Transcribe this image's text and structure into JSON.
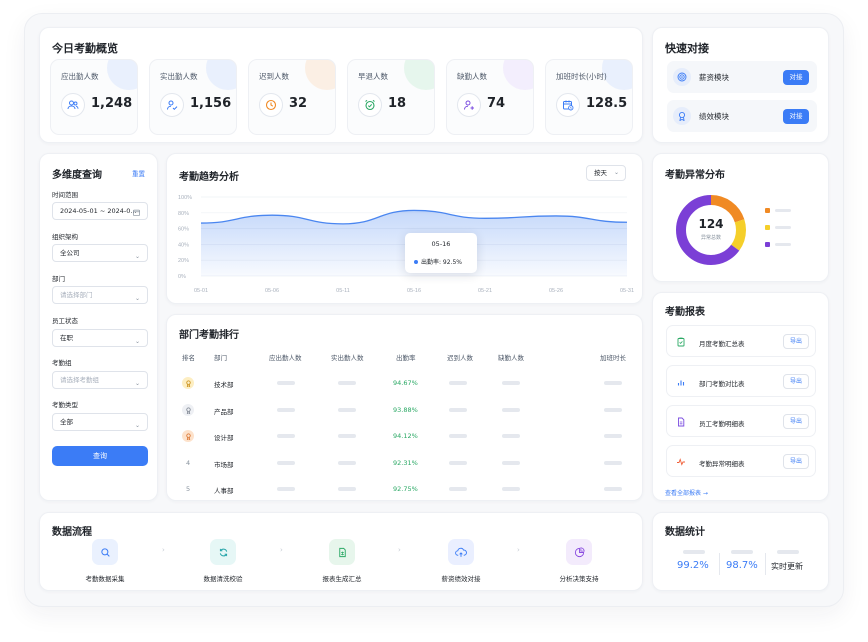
{
  "overview": {
    "title": "今日考勤概览",
    "stats": [
      {
        "label": "应出勤人数",
        "value": "1,248",
        "icon": "users-icon",
        "color": "#3b7cf6"
      },
      {
        "label": "实出勤人数",
        "value": "1,156",
        "icon": "user-check-icon",
        "color": "#3b7cf6"
      },
      {
        "label": "迟到人数",
        "value": "32",
        "icon": "clock-icon",
        "color": "#f08a24"
      },
      {
        "label": "早退人数",
        "value": "18",
        "icon": "alarm-icon",
        "color": "#2aa864"
      },
      {
        "label": "缺勤人数",
        "value": "74",
        "icon": "user-minus-icon",
        "color": "#7b4de0"
      },
      {
        "label": "加班时长(小时)",
        "value": "128.5",
        "icon": "calendar-clock-icon",
        "color": "#3b7cf6"
      }
    ]
  },
  "quick": {
    "title": "快速对接",
    "items": [
      {
        "label": "薪资模块",
        "button": "对接",
        "icon": "target-icon"
      },
      {
        "label": "绩效模块",
        "button": "对接",
        "icon": "award-icon"
      }
    ]
  },
  "query": {
    "title": "多维度查询",
    "reset": "重置",
    "fields": [
      {
        "label": "时间范围",
        "value": "2024-05-01 ~ 2024-0...",
        "placeholder": false,
        "suffix": "calendar"
      },
      {
        "label": "组织架构",
        "value": "全公司",
        "placeholder": false,
        "suffix": "chevron"
      },
      {
        "label": "部门",
        "value": "请选择部门",
        "placeholder": true,
        "suffix": "chevron"
      },
      {
        "label": "员工状态",
        "value": "在职",
        "placeholder": false,
        "suffix": "chevron"
      },
      {
        "label": "考勤组",
        "value": "请选择考勤组",
        "placeholder": true,
        "suffix": "chevron"
      },
      {
        "label": "考勤类型",
        "value": "全部",
        "placeholder": false,
        "suffix": "chevron"
      }
    ],
    "submit": "查询"
  },
  "trend": {
    "title": "考勤趋势分析",
    "period_select": "按天",
    "tooltip": {
      "date": "05-16",
      "label": "出勤率: 92.5%"
    }
  },
  "chart_data": {
    "type": "area",
    "x": [
      "05-01",
      "05-06",
      "05-11",
      "05-16",
      "05-21",
      "05-26",
      "05-31"
    ],
    "series": [
      {
        "values": [
          67,
          77,
          66,
          83,
          73,
          76,
          68
        ]
      }
    ],
    "yticks": [
      "100%",
      "80%",
      "60%",
      "40%",
      "20%",
      "0%"
    ],
    "ylim": [
      0,
      100
    ],
    "color": "#4a86f0"
  },
  "ranking": {
    "title": "部门考勤排行",
    "headers": [
      "排名",
      "部门",
      "应出勤人数",
      "实出勤人数",
      "出勤率",
      "迟到人数",
      "缺勤人数",
      "加班时长"
    ],
    "rows": [
      {
        "rank": "",
        "medal": "gold",
        "dept": "技术部",
        "rate": "94.67%"
      },
      {
        "rank": "",
        "medal": "silver",
        "dept": "产品部",
        "rate": "93.88%"
      },
      {
        "rank": "",
        "medal": "bronze",
        "dept": "设计部",
        "rate": "94.12%"
      },
      {
        "rank": "4",
        "medal": "",
        "dept": "市场部",
        "rate": "92.31%"
      },
      {
        "rank": "5",
        "medal": "",
        "dept": "人事部",
        "rate": "92.75%"
      }
    ]
  },
  "anomaly": {
    "title": "考勤异常分布",
    "total": "124",
    "total_label": "异常总数",
    "slices": [
      {
        "value": 20,
        "color": "#f08a24"
      },
      {
        "value": 15,
        "color": "#f5cf2a"
      },
      {
        "value": 65,
        "color": "#7b3fd6"
      }
    ]
  },
  "reports": {
    "title": "考勤报表",
    "items": [
      {
        "label": "月度考勤汇总表",
        "button": "导出",
        "icon": "clipboard-icon",
        "color": "#2aa864"
      },
      {
        "label": "部门考勤对比表",
        "button": "导出",
        "icon": "bar-chart-icon",
        "color": "#3b7cf6"
      },
      {
        "label": "员工考勤明细表",
        "button": "导出",
        "icon": "document-icon",
        "color": "#7b4de0"
      },
      {
        "label": "考勤异常明细表",
        "button": "导出",
        "icon": "pulse-icon",
        "color": "#f0603a"
      }
    ],
    "view_all": "查看全部报表 →"
  },
  "flow": {
    "title": "数据流程",
    "steps": [
      {
        "label": "考勤数据采集",
        "icon": "search-icon",
        "color": "#3b7cf6",
        "bg": "#eaf1fe"
      },
      {
        "label": "数据清洗校验",
        "icon": "refresh-icon",
        "color": "#22a3a8",
        "bg": "#e6f7f6"
      },
      {
        "label": "报表生成汇总",
        "icon": "sheet-icon",
        "color": "#2aa864",
        "bg": "#e7f6ec"
      },
      {
        "label": "薪资绩效对接",
        "icon": "upload-cloud-icon",
        "color": "#3b7cf6",
        "bg": "#eaefff"
      },
      {
        "label": "分析决策支持",
        "icon": "pie-icon",
        "color": "#8b4de0",
        "bg": "#f3ebfc"
      }
    ]
  },
  "stats": {
    "title": "数据统计",
    "items": [
      {
        "value": "99.2%"
      },
      {
        "value": "98.7%"
      },
      {
        "value": "实时更新"
      }
    ]
  }
}
